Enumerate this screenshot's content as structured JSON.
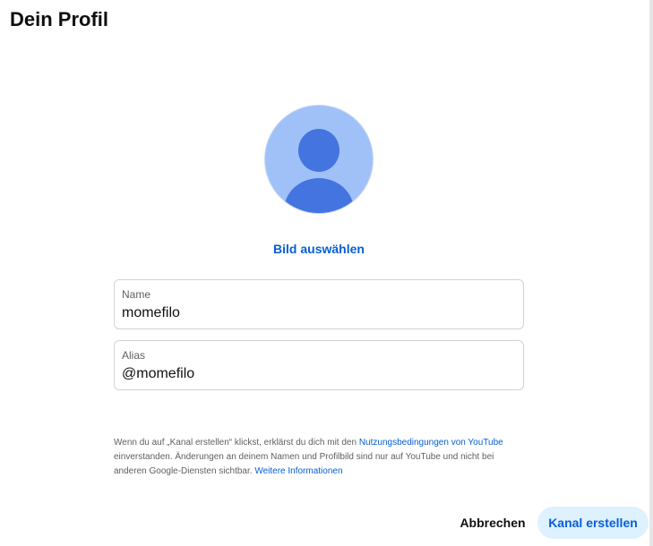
{
  "dialog": {
    "title": "Dein Profil"
  },
  "avatar": {
    "icon": "default-avatar-icon",
    "background_color": "#a0c1f7",
    "figure_color": "#4374e0",
    "pick_label": "Bild auswählen"
  },
  "fields": {
    "name": {
      "label": "Name",
      "value": "momefilo"
    },
    "alias": {
      "label": "Alias",
      "value": "@momefilo"
    }
  },
  "legal": {
    "part1": "Wenn du auf „Kanal erstellen“ klickst, erklärst du dich mit den ",
    "terms_link": "Nutzungsbedingungen von YouTube",
    "part2": " einverstanden. Änderungen an deinem Namen und Profilbild sind nur auf YouTube und nicht bei anderen Google-Diensten sichtbar. ",
    "more_link": "Weitere Informationen"
  },
  "actions": {
    "cancel_label": "Abbrechen",
    "create_label": "Kanal erstellen"
  },
  "colors": {
    "accent": "#065fd4",
    "create_button_bg": "#def1ff"
  }
}
